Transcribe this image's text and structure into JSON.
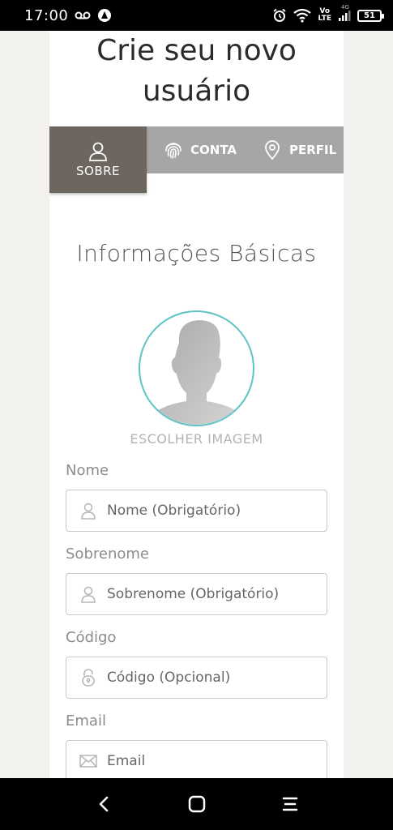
{
  "status_bar": {
    "time": "17:00",
    "network": "4G",
    "volte_top": "Vo",
    "volte_bottom": "LTE",
    "battery": "51"
  },
  "page": {
    "title_line1": "Crie seu novo",
    "title_line2": "usuário"
  },
  "tabs": [
    {
      "label": "SOBRE",
      "icon": "user-icon",
      "active": true
    },
    {
      "label": "CONTA",
      "icon": "fingerprint-icon",
      "active": false
    },
    {
      "label": "PERFIL",
      "icon": "location-pin-icon",
      "active": false
    }
  ],
  "section": {
    "title": "Informações Básicas",
    "choose_image": "ESCOLHER IMAGEM"
  },
  "form": {
    "nome": {
      "label": "Nome",
      "placeholder": "Nome (Obrigatório)"
    },
    "sobrenome": {
      "label": "Sobrenome",
      "placeholder": "Sobrenome (Obrigatório)"
    },
    "codigo": {
      "label": "Código",
      "placeholder": "Código (Opcional)"
    },
    "email": {
      "label": "Email",
      "placeholder": "Email"
    }
  },
  "colors": {
    "active_tab": "#6d665f",
    "inactive_tabs": "#a6a6a6",
    "avatar_ring": "#5ec3c6",
    "page_background": "#f2f1ee"
  }
}
